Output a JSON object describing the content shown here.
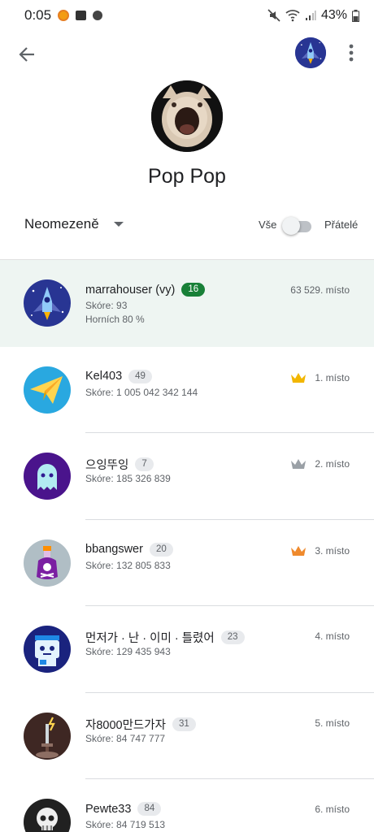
{
  "status_bar": {
    "time": "0:05",
    "battery": "43%"
  },
  "header": {
    "back_icon": "arrow-back-icon",
    "menu_icon": "more-vert-icon"
  },
  "game": {
    "title": "Pop Pop"
  },
  "filter": {
    "time_range": "Neomezeně",
    "scope_all": "Vše",
    "scope_friends": "Přátelé",
    "friends_only": false
  },
  "leaderboard": [
    {
      "name": "marrahouser (vy)",
      "level": "16",
      "score": "Skóre: 93",
      "percentile": "Horních 80 %",
      "rank": "63 529. místo",
      "is_me": true,
      "crown": "",
      "avatar": "rocket"
    },
    {
      "name": "Kel403",
      "level": "49",
      "score": "Skóre: 1 005 042 342 144",
      "rank": "1. místo",
      "crown": "gold",
      "avatar": "paper-plane"
    },
    {
      "name": "으잉뚜잉",
      "level": "7",
      "score": "Skóre: 185 326 839",
      "rank": "2. místo",
      "crown": "silver",
      "avatar": "ghost"
    },
    {
      "name": "bbangswer",
      "level": "20",
      "score": "Skóre: 132 805 833",
      "rank": "3. místo",
      "crown": "bronze",
      "avatar": "poison-bottle"
    },
    {
      "name": "먼저가 · 난 · 이미 · 틀렸어",
      "level": "23",
      "score": "Skóre: 129 435 943",
      "rank": "4. místo",
      "crown": "",
      "avatar": "robot"
    },
    {
      "name": "자8000만드가자",
      "level": "31",
      "score": "Skóre: 84 747 777",
      "rank": "5. místo",
      "crown": "",
      "avatar": "sword"
    },
    {
      "name": "Pewte33",
      "level": "84",
      "score": "Skóre: 84 719 513",
      "rank": "6. místo",
      "crown": "",
      "avatar": "skeleton"
    }
  ],
  "colors": {
    "gold": "#f2b600",
    "silver": "#9aa0a6",
    "bronze": "#ef8a2d",
    "accent": "#188038"
  }
}
